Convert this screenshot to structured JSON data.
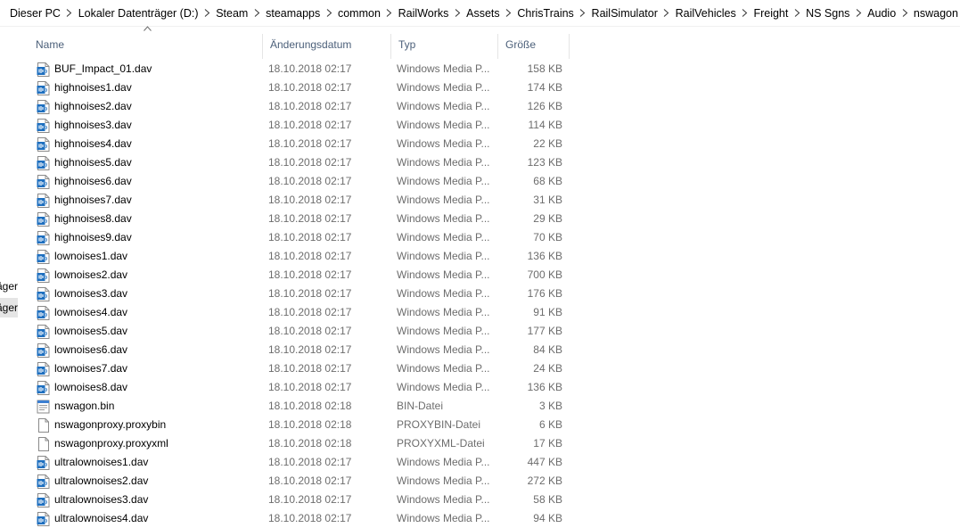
{
  "breadcrumb": [
    "Dieser PC",
    "Lokaler Datenträger (D:)",
    "Steam",
    "steamapps",
    "common",
    "RailWorks",
    "Assets",
    "ChrisTrains",
    "RailSimulator",
    "RailVehicles",
    "Freight",
    "NS Sgns",
    "Audio",
    "nswagon"
  ],
  "nav": {
    "item1": "Lokaler Datenträger",
    "item2": "Lokaler Datenträger"
  },
  "columns": {
    "name": "Name",
    "date": "Änderungsdatum",
    "type": "Typ",
    "size": "Größe"
  },
  "icons": {
    "media": "media-file-icon",
    "bin": "bin-file-icon",
    "generic": "generic-file-icon"
  },
  "files": [
    {
      "name": "BUF_Impact_01.dav",
      "date": "18.10.2018 02:17",
      "type": "Windows Media P...",
      "size": "158 KB",
      "icon": "media"
    },
    {
      "name": "highnoises1.dav",
      "date": "18.10.2018 02:17",
      "type": "Windows Media P...",
      "size": "174 KB",
      "icon": "media"
    },
    {
      "name": "highnoises2.dav",
      "date": "18.10.2018 02:17",
      "type": "Windows Media P...",
      "size": "126 KB",
      "icon": "media"
    },
    {
      "name": "highnoises3.dav",
      "date": "18.10.2018 02:17",
      "type": "Windows Media P...",
      "size": "114 KB",
      "icon": "media"
    },
    {
      "name": "highnoises4.dav",
      "date": "18.10.2018 02:17",
      "type": "Windows Media P...",
      "size": "22 KB",
      "icon": "media"
    },
    {
      "name": "highnoises5.dav",
      "date": "18.10.2018 02:17",
      "type": "Windows Media P...",
      "size": "123 KB",
      "icon": "media"
    },
    {
      "name": "highnoises6.dav",
      "date": "18.10.2018 02:17",
      "type": "Windows Media P...",
      "size": "68 KB",
      "icon": "media"
    },
    {
      "name": "highnoises7.dav",
      "date": "18.10.2018 02:17",
      "type": "Windows Media P...",
      "size": "31 KB",
      "icon": "media"
    },
    {
      "name": "highnoises8.dav",
      "date": "18.10.2018 02:17",
      "type": "Windows Media P...",
      "size": "29 KB",
      "icon": "media"
    },
    {
      "name": "highnoises9.dav",
      "date": "18.10.2018 02:17",
      "type": "Windows Media P...",
      "size": "70 KB",
      "icon": "media"
    },
    {
      "name": "lownoises1.dav",
      "date": "18.10.2018 02:17",
      "type": "Windows Media P...",
      "size": "136 KB",
      "icon": "media"
    },
    {
      "name": "lownoises2.dav",
      "date": "18.10.2018 02:17",
      "type": "Windows Media P...",
      "size": "700 KB",
      "icon": "media"
    },
    {
      "name": "lownoises3.dav",
      "date": "18.10.2018 02:17",
      "type": "Windows Media P...",
      "size": "176 KB",
      "icon": "media"
    },
    {
      "name": "lownoises4.dav",
      "date": "18.10.2018 02:17",
      "type": "Windows Media P...",
      "size": "91 KB",
      "icon": "media"
    },
    {
      "name": "lownoises5.dav",
      "date": "18.10.2018 02:17",
      "type": "Windows Media P...",
      "size": "177 KB",
      "icon": "media"
    },
    {
      "name": "lownoises6.dav",
      "date": "18.10.2018 02:17",
      "type": "Windows Media P...",
      "size": "84 KB",
      "icon": "media"
    },
    {
      "name": "lownoises7.dav",
      "date": "18.10.2018 02:17",
      "type": "Windows Media P...",
      "size": "24 KB",
      "icon": "media"
    },
    {
      "name": "lownoises8.dav",
      "date": "18.10.2018 02:17",
      "type": "Windows Media P...",
      "size": "136 KB",
      "icon": "media"
    },
    {
      "name": "nswagon.bin",
      "date": "18.10.2018 02:18",
      "type": "BIN-Datei",
      "size": "3 KB",
      "icon": "bin"
    },
    {
      "name": "nswagonproxy.proxybin",
      "date": "18.10.2018 02:18",
      "type": "PROXYBIN-Datei",
      "size": "6 KB",
      "icon": "generic"
    },
    {
      "name": "nswagonproxy.proxyxml",
      "date": "18.10.2018 02:18",
      "type": "PROXYXML-Datei",
      "size": "17 KB",
      "icon": "generic"
    },
    {
      "name": "ultralownoises1.dav",
      "date": "18.10.2018 02:17",
      "type": "Windows Media P...",
      "size": "447 KB",
      "icon": "media"
    },
    {
      "name": "ultralownoises2.dav",
      "date": "18.10.2018 02:17",
      "type": "Windows Media P...",
      "size": "272 KB",
      "icon": "media"
    },
    {
      "name": "ultralownoises3.dav",
      "date": "18.10.2018 02:17",
      "type": "Windows Media P...",
      "size": "58 KB",
      "icon": "media"
    },
    {
      "name": "ultralownoises4.dav",
      "date": "18.10.2018 02:17",
      "type": "Windows Media P...",
      "size": "94 KB",
      "icon": "media"
    }
  ],
  "colors": {
    "header_text": "#4c607a",
    "meta_text": "#6d6d6d",
    "media_icon_blue": "#1e6fbf"
  }
}
